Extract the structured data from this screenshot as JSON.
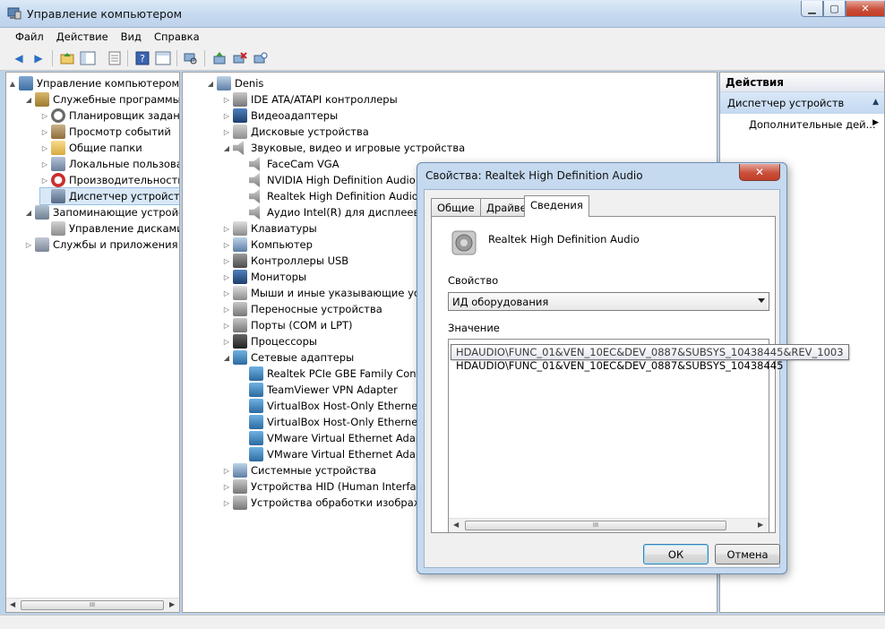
{
  "window": {
    "title": "Управление компьютером"
  },
  "menu": [
    "Файл",
    "Действие",
    "Вид",
    "Справка"
  ],
  "toolbar": {
    "icons": [
      "back-icon",
      "forward-icon",
      "up-folder-icon",
      "show-hide-tree-icon",
      "export-list-icon",
      "help-icon",
      "console-tree-icon",
      "scan-hardware-icon",
      "update-driver-icon",
      "uninstall-device-icon",
      "disable-device-icon"
    ]
  },
  "left_tree": [
    {
      "label": "Управление компьютером (л",
      "icon": "computer-management-icon",
      "level": 0,
      "expander": "▲"
    },
    {
      "label": "Служебные программы",
      "icon": "system-tools-icon",
      "level": 1,
      "expander": "◢"
    },
    {
      "label": "Планировщик заданий",
      "icon": "task-scheduler-icon",
      "level": 2,
      "expander": "▷"
    },
    {
      "label": "Просмотр событий",
      "icon": "event-viewer-icon",
      "level": 2,
      "expander": "▷"
    },
    {
      "label": "Общие папки",
      "icon": "shared-folders-icon",
      "level": 2,
      "expander": "▷"
    },
    {
      "label": "Локальные пользовате",
      "icon": "local-users-icon",
      "level": 2,
      "expander": "▷"
    },
    {
      "label": "Производительность",
      "icon": "performance-icon",
      "level": 2,
      "expander": "▷"
    },
    {
      "label": "Диспетчер устройств",
      "icon": "device-manager-icon",
      "level": 2,
      "expander": "",
      "selected": true
    },
    {
      "label": "Запоминающие устройст",
      "icon": "storage-icon",
      "level": 1,
      "expander": "◢"
    },
    {
      "label": "Управление дисками",
      "icon": "disk-management-icon",
      "level": 2,
      "expander": ""
    },
    {
      "label": "Службы и приложения",
      "icon": "services-apps-icon",
      "level": 1,
      "expander": "▷"
    }
  ],
  "device_tree": [
    {
      "label": "Denis",
      "icon": "computer-icon",
      "level": 0,
      "expander": "◢"
    },
    {
      "label": "IDE ATA/ATAPI контроллеры",
      "icon": "ide-controller-icon",
      "level": 1,
      "expander": "▷"
    },
    {
      "label": "Видеоадаптеры",
      "icon": "display-adapter-icon",
      "level": 1,
      "expander": "▷"
    },
    {
      "label": "Дисковые устройства",
      "icon": "disk-drive-icon",
      "level": 1,
      "expander": "▷"
    },
    {
      "label": "Звуковые, видео и игровые устройства",
      "icon": "sound-device-icon",
      "level": 1,
      "expander": "◢"
    },
    {
      "label": "FaceCam VGA",
      "icon": "speaker-icon",
      "level": 2,
      "expander": ""
    },
    {
      "label": "NVIDIA High Definition Audio",
      "icon": "speaker-icon",
      "level": 2,
      "expander": ""
    },
    {
      "label": "Realtek High Definition Audio",
      "icon": "speaker-icon",
      "level": 2,
      "expander": ""
    },
    {
      "label": "Аудио Intel(R) для дисплеев",
      "icon": "speaker-icon",
      "level": 2,
      "expander": ""
    },
    {
      "label": "Клавиатуры",
      "icon": "keyboard-icon",
      "level": 1,
      "expander": "▷"
    },
    {
      "label": "Компьютер",
      "icon": "computer-icon",
      "level": 1,
      "expander": "▷"
    },
    {
      "label": "Контроллеры USB",
      "icon": "usb-icon",
      "level": 1,
      "expander": "▷"
    },
    {
      "label": "Мониторы",
      "icon": "monitor-icon",
      "level": 1,
      "expander": "▷"
    },
    {
      "label": "Мыши и иные указывающие устрой",
      "icon": "mouse-icon",
      "level": 1,
      "expander": "▷"
    },
    {
      "label": "Переносные устройства",
      "icon": "portable-device-icon",
      "level": 1,
      "expander": "▷"
    },
    {
      "label": "Порты (COM и LPT)",
      "icon": "port-icon",
      "level": 1,
      "expander": "▷"
    },
    {
      "label": "Процессоры",
      "icon": "processor-icon",
      "level": 1,
      "expander": "▷"
    },
    {
      "label": "Сетевые адаптеры",
      "icon": "network-adapter-icon",
      "level": 1,
      "expander": "◢"
    },
    {
      "label": "Realtek PCIe GBE Family Controller",
      "icon": "network-card-icon",
      "level": 2,
      "expander": ""
    },
    {
      "label": "TeamViewer VPN Adapter",
      "icon": "network-card-icon",
      "level": 2,
      "expander": ""
    },
    {
      "label": "VirtualBox Host-Only Ethernet Ada",
      "icon": "network-card-icon",
      "level": 2,
      "expander": ""
    },
    {
      "label": "VirtualBox Host-Only Ethernet Ada",
      "icon": "network-card-icon",
      "level": 2,
      "expander": ""
    },
    {
      "label": "VMware Virtual Ethernet Adapter fo",
      "icon": "network-card-icon",
      "level": 2,
      "expander": ""
    },
    {
      "label": "VMware Virtual Ethernet Adapter fo",
      "icon": "network-card-icon",
      "level": 2,
      "expander": ""
    },
    {
      "label": "Системные устройства",
      "icon": "system-device-icon",
      "level": 1,
      "expander": "▷"
    },
    {
      "label": "Устройства HID (Human Interface Dev",
      "icon": "hid-icon",
      "level": 1,
      "expander": "▷"
    },
    {
      "label": "Устройства обработки изображений",
      "icon": "imaging-device-icon",
      "level": 1,
      "expander": "▷"
    }
  ],
  "actions": {
    "header": "Действия",
    "section": "Диспетчер устройств",
    "more": "Дополнительные дей..."
  },
  "dialog": {
    "title": "Свойства: Realtek High Definition Audio",
    "close": "✕",
    "tabs": [
      "Общие",
      "Драйвер",
      "Сведения"
    ],
    "active_tab": "Сведения",
    "device_name": "Realtek High Definition Audio",
    "property_label": "Свойство",
    "property_value": "ИД оборудования",
    "value_label": "Значение",
    "values": [
      "HDAUDIO\\FUNC_01&VEN_10EC&DEV_0887&SUBSYS_10438445&REV_1003",
      "HDAUDIO\\FUNC_01&VEN_10EC&DEV_0887&SUBSYS_10438445"
    ],
    "ok": "ОК",
    "cancel": "Отмена"
  },
  "scrollbar": {
    "thumb_grip": "III",
    "left": "◀",
    "right": "▶"
  },
  "colors": {
    "titlebar": "#c5d9ef",
    "selection": "#cde3f7",
    "close_button": "#c9503b"
  }
}
